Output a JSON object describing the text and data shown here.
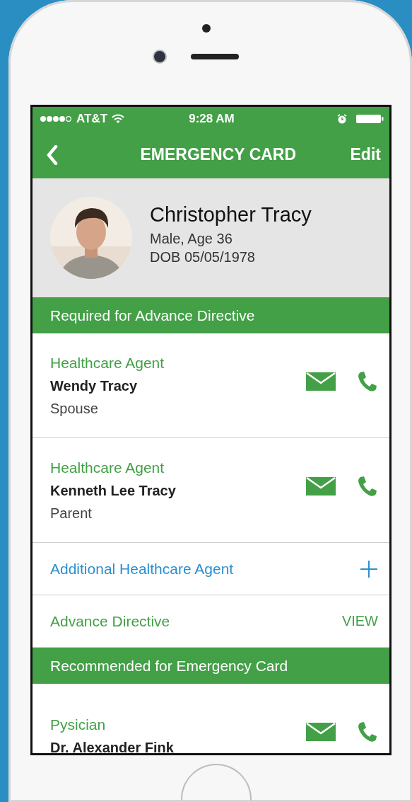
{
  "status_bar": {
    "carrier": "AT&T",
    "time": "9:28 AM"
  },
  "nav": {
    "title": "EMERGENCY CARD",
    "action": "Edit"
  },
  "profile": {
    "name": "Christopher Tracy",
    "details": [
      "Male, Age 36",
      "DOB 05/05/1978"
    ]
  },
  "sections": [
    {
      "title": "Required for Advance Directive",
      "rows": [
        {
          "kind": "contact",
          "label": "Healthcare Agent",
          "name": "Wendy Tracy",
          "relation": "Spouse"
        },
        {
          "kind": "contact",
          "label": "Healthcare Agent",
          "name": "Kenneth Lee Tracy",
          "relation": "Parent"
        },
        {
          "kind": "add",
          "label": "Additional Healthcare Agent"
        },
        {
          "kind": "link",
          "label": "Advance Directive",
          "action": "VIEW"
        }
      ]
    },
    {
      "title": "Recommended for Emergency Card",
      "rows": [
        {
          "kind": "contact",
          "label": "Pysician",
          "name": "Dr. Alexander Fink"
        }
      ]
    }
  ]
}
